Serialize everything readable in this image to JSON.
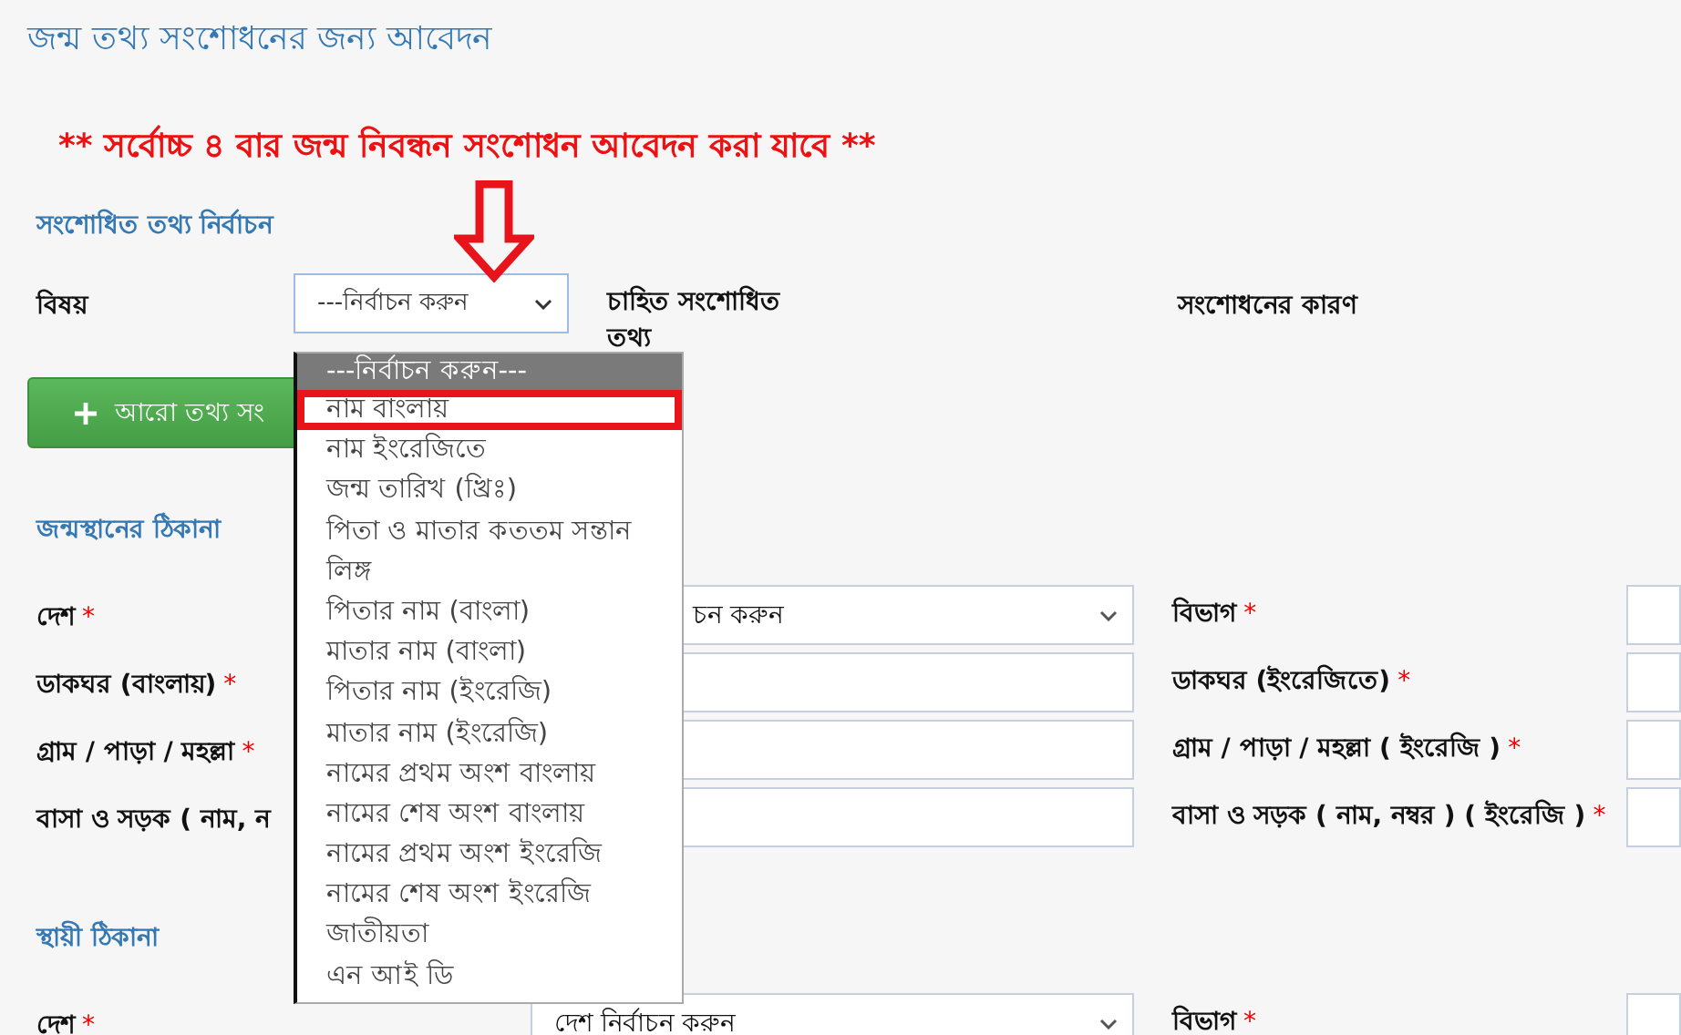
{
  "page_title": "জন্ম তথ্য সংশোধনের জন্য আবেদন",
  "notice": "** সর্বোচ্চ ৪ বার জন্ম নিবন্ধন সংশোধন আবেদন করা যাবে **",
  "selection_section": {
    "heading": "সংশোধিত তথ্য নির্বাচন",
    "subject_label": "বিষয়",
    "subject_select": {
      "value": "---নির্বাচন করুন",
      "expanded": true
    },
    "column_2": "চাহিত সংশোধিত তথ্য",
    "column_3": "সংশোধনের কারণ",
    "add_button": "আরো তথ্য সং"
  },
  "dropdown_options": [
    {
      "label": "---নির্বাচন করুন---",
      "selected": true,
      "highlighted": false
    },
    {
      "label": "নাম বাংলায়",
      "selected": false,
      "highlighted": true
    },
    {
      "label": "নাম ইংরেজিতে",
      "selected": false,
      "highlighted": false
    },
    {
      "label": "জন্ম তারিখ (খ্রিঃ)",
      "selected": false,
      "highlighted": false
    },
    {
      "label": "পিতা ও মাতার কততম সন্তান",
      "selected": false,
      "highlighted": false
    },
    {
      "label": "লিঙ্গ",
      "selected": false,
      "highlighted": false
    },
    {
      "label": "পিতার নাম (বাংলা)",
      "selected": false,
      "highlighted": false
    },
    {
      "label": "মাতার নাম (বাংলা)",
      "selected": false,
      "highlighted": false
    },
    {
      "label": "পিতার নাম (ইংরেজি)",
      "selected": false,
      "highlighted": false
    },
    {
      "label": "মাতার নাম (ইংরেজি)",
      "selected": false,
      "highlighted": false
    },
    {
      "label": "নামের প্রথম অংশ বাংলায়",
      "selected": false,
      "highlighted": false
    },
    {
      "label": "নামের শেষ অংশ বাংলায়",
      "selected": false,
      "highlighted": false
    },
    {
      "label": "নামের প্রথম অংশ ইংরেজি",
      "selected": false,
      "highlighted": false
    },
    {
      "label": "নামের শেষ অংশ ইংরেজি",
      "selected": false,
      "highlighted": false
    },
    {
      "label": "জাতীয়তা",
      "selected": false,
      "highlighted": false
    },
    {
      "label": "এন আই ডি",
      "selected": false,
      "highlighted": false
    }
  ],
  "birthplace_address": {
    "heading": "জন্মস্থানের ঠিকানা",
    "rows": [
      {
        "left": {
          "label": "দেশ",
          "required_mark": "*",
          "kind": "select",
          "value": "চন করুন"
        },
        "right": {
          "label": "বিভাগ",
          "required_mark": "*"
        }
      },
      {
        "left": {
          "label": "ডাকঘর (বাংলায়)",
          "required_mark": "*",
          "kind": "text"
        },
        "right": {
          "label": "ডাকঘর (ইংরেজিতে)",
          "required_mark": "*"
        }
      },
      {
        "left": {
          "label": "গ্রাম / পাড়া / মহল্লা",
          "required_mark": "*",
          "kind": "text"
        },
        "right": {
          "label": "গ্রাম / পাড়া / মহল্লা ( ইংরেজি )",
          "required_mark": "*"
        }
      },
      {
        "left": {
          "label": "বাসা ও সড়ক ( নাম, ন",
          "kind": "text"
        },
        "right": {
          "label": "বাসা ও সড়ক ( নাম, নম্বর ) ( ইংরেজি )",
          "required_mark": "*"
        }
      }
    ]
  },
  "permanent_address": {
    "heading": "স্থায়ী ঠিকানা",
    "rows": [
      {
        "left": {
          "label": "দেশ",
          "required_mark": "*",
          "kind": "select",
          "value": "দেশ নির্বাচন করুন"
        },
        "right": {
          "label": "বিভাগ",
          "required_mark": "*"
        }
      }
    ]
  }
}
